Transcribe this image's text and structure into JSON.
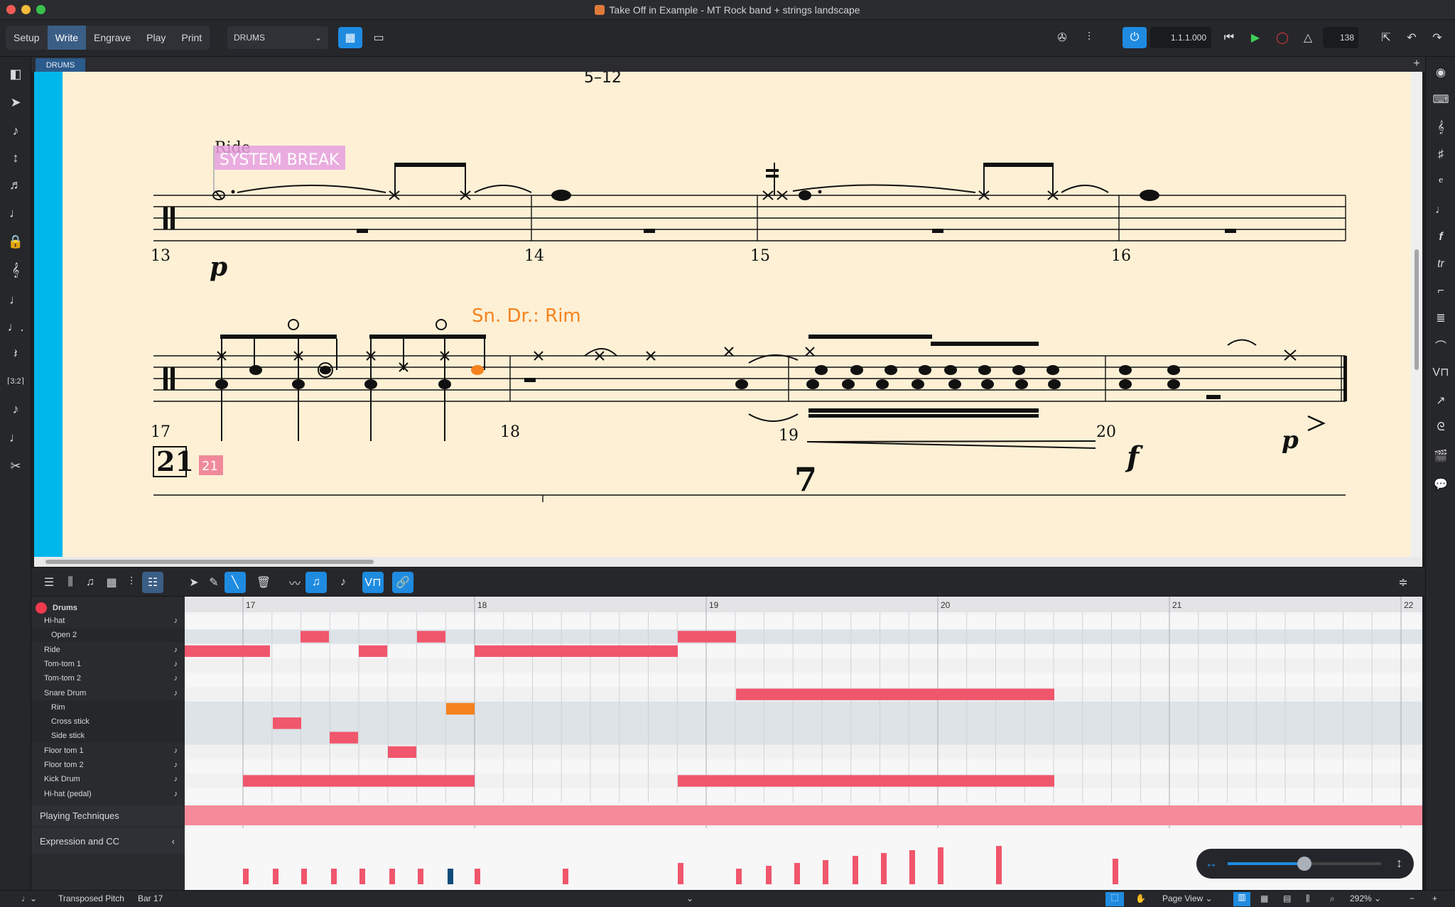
{
  "window": {
    "title": "Take Off in Example - MT Rock band + strings landscape"
  },
  "toolbar": {
    "modes": [
      "Setup",
      "Write",
      "Engrave",
      "Play",
      "Print"
    ],
    "active_mode": "Write",
    "layout": "DRUMS",
    "position": "1.1.1.000",
    "tempo": "138"
  },
  "tabs": {
    "current": "DRUMS",
    "add": "+"
  },
  "score": {
    "system1": {
      "page_label": "5–12",
      "technique": "Ride",
      "system_break": "SYSTEM BREAK",
      "bars": [
        "13",
        "14",
        "15",
        "16"
      ],
      "dynamic": "p"
    },
    "system2": {
      "technique": "Sn. Dr.: Rim",
      "bars": [
        "17",
        "18",
        "19",
        "20"
      ],
      "dynamics": [
        "f",
        "p"
      ]
    },
    "system3": {
      "rehearsal": "21",
      "marker": "21",
      "multirest": "7"
    }
  },
  "key_editor": {
    "instrument": "Drums",
    "rows": [
      {
        "label": "Hi-hat",
        "sub": false,
        "note": true
      },
      {
        "label": "Open 2",
        "sub": true,
        "note": false
      },
      {
        "label": "Ride",
        "sub": false,
        "note": true
      },
      {
        "label": "Tom-tom 1",
        "sub": false,
        "note": true
      },
      {
        "label": "Tom-tom 2",
        "sub": false,
        "note": true
      },
      {
        "label": "Snare Drum",
        "sub": false,
        "note": true
      },
      {
        "label": "Rim",
        "sub": true,
        "note": false
      },
      {
        "label": "Cross stick",
        "sub": true,
        "note": false
      },
      {
        "label": "Side stick",
        "sub": true,
        "note": false
      },
      {
        "label": "Floor tom 1",
        "sub": false,
        "note": true
      },
      {
        "label": "Floor tom 2",
        "sub": false,
        "note": true
      },
      {
        "label": "Kick Drum",
        "sub": false,
        "note": true
      },
      {
        "label": "Hi-hat (pedal)",
        "sub": false,
        "note": true
      }
    ],
    "ruler": [
      "17",
      "18",
      "19",
      "20",
      "21",
      "22"
    ],
    "playing_techniques": "Playing Techniques",
    "expression_cc": "Expression and CC"
  },
  "status_bar": {
    "pitch_mode": "Transposed Pitch",
    "bar": "Bar 17",
    "view": "Page View",
    "zoom": "292%"
  },
  "colors": {
    "accent_blue": "#1f8be0",
    "note_pink": "#f0566c",
    "selected_orange": "#f5821f",
    "score_bg": "#fdf0d5",
    "score_edge": "#00b7ec"
  }
}
